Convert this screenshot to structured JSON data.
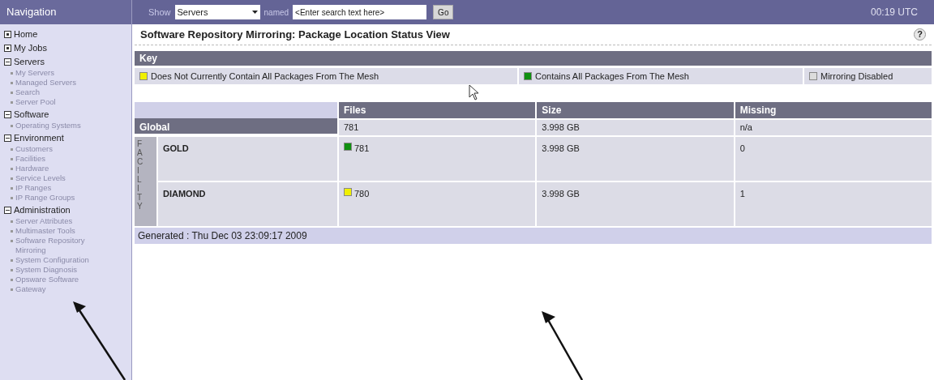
{
  "sidebar": {
    "title": "Navigation",
    "items": [
      {
        "label": "Home",
        "kind": "leaf"
      },
      {
        "label": "My Jobs",
        "kind": "leaf"
      },
      {
        "label": "Servers",
        "kind": "section",
        "expanded": true,
        "children": [
          "My Servers",
          "Managed Servers",
          "Search",
          "Server Pool"
        ]
      },
      {
        "label": "Software",
        "kind": "section",
        "expanded": true,
        "children": [
          "Operating Systems"
        ]
      },
      {
        "label": "Environment",
        "kind": "section",
        "expanded": true,
        "children": [
          "Customers",
          "Facilities",
          "Hardware",
          "Service Levels",
          "IP Ranges",
          "IP Range Groups"
        ]
      },
      {
        "label": "Administration",
        "kind": "section",
        "expanded": true,
        "children": [
          "Server Attributes",
          "Multimaster Tools",
          "Software Repository Mirroring",
          "System Configuration",
          "System Diagnosis",
          "Opsware Software",
          "Gateway"
        ]
      }
    ]
  },
  "top_bar": {
    "show_label": "Show",
    "show_value": "Servers",
    "named_label": "named",
    "search": {
      "value": "<Enter search text here>"
    },
    "go_button": "Go",
    "time": "00:19 UTC"
  },
  "page_title": "Software Repository Mirroring: Package Location Status View",
  "help_button": "?",
  "key": {
    "title": "Key",
    "items": [
      {
        "label": "Does Not Currently Contain All Packages From The Mesh",
        "color": "#f0f000"
      },
      {
        "label": "Contains All Packages From The Mesh",
        "color": "#109010"
      },
      {
        "label": "Mirroring Disabled",
        "color": "#dcdcdc"
      }
    ]
  },
  "table": {
    "columns": [
      "Files",
      "Size",
      "Missing"
    ],
    "global": {
      "label": "Global",
      "files": "781",
      "size": "3.998 GB",
      "missing": "n/a"
    },
    "group_label": "FACILITY",
    "rows": [
      {
        "name": "GOLD",
        "color": "#109010",
        "files": "781",
        "size": "3.998 GB",
        "missing": "0"
      },
      {
        "name": "DIAMOND",
        "color": "#f0f000",
        "files": "780",
        "size": "3.998 GB",
        "missing": "1"
      }
    ]
  },
  "footer": "Generated : Thu Dec 03 23:09:17 2009"
}
